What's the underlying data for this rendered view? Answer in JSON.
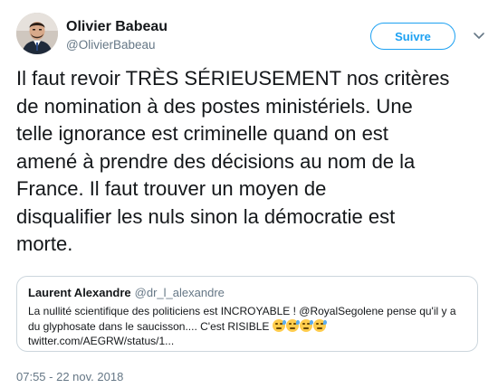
{
  "author": {
    "name": "Olivier Babeau",
    "handle": "@OlivierBabeau"
  },
  "follow_button": {
    "label": "Suivre"
  },
  "tweet": {
    "text": "Il faut revoir TRÈS SÉRIEUSEMENT nos critères\nde nomination à des postes ministériels. Une\ntelle ignorance est criminelle quand on est\namené à prendre des décisions au nom de la\nFrance. Il faut trouver un moyen de\ndisqualifier les nuls sinon la démocratie est\nmorte."
  },
  "quoted_tweet": {
    "name": "Laurent Alexandre",
    "handle": "@dr_l_alexandre",
    "line1": "La nullité scientifique des politiciens est INCROYABLE ! @RoyalSegolene pense qu'il y a",
    "line2": "du glyphosate dans le saucisson.... C'est RISIBLE",
    "line3": "twitter.com/AEGRW/status/1...",
    "emoji": "sad-sweat-face-emoji"
  },
  "timestamp": "07:55 - 22 nov. 2018",
  "colors": {
    "accent": "#1da1f2",
    "text": "#14171a",
    "secondary": "#657786",
    "border": "#ccd6dd"
  }
}
